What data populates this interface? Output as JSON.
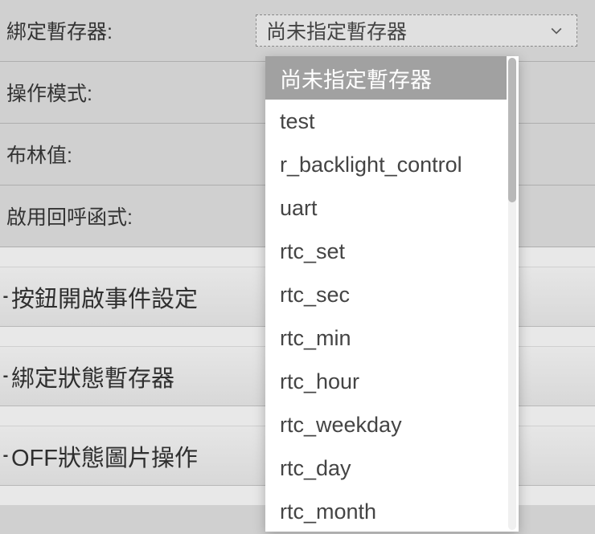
{
  "form": {
    "bind_register_label": "綁定暫存器:",
    "bind_register_value": "尚未指定暫存器",
    "mode_label": "操作模式:",
    "bool_label": "布林值:",
    "callback_label": "啟用回呼函式:"
  },
  "sections": {
    "button_on_event": "按鈕開啟事件設定",
    "bind_state_register": "綁定狀態暫存器",
    "off_state_image": "OFF狀態圖片操作"
  },
  "dropdown_options": [
    "尚未指定暫存器",
    "test",
    "r_backlight_control",
    "uart",
    "rtc_set",
    "rtc_sec",
    "rtc_min",
    "rtc_hour",
    "rtc_weekday",
    "rtc_day",
    "rtc_month"
  ]
}
